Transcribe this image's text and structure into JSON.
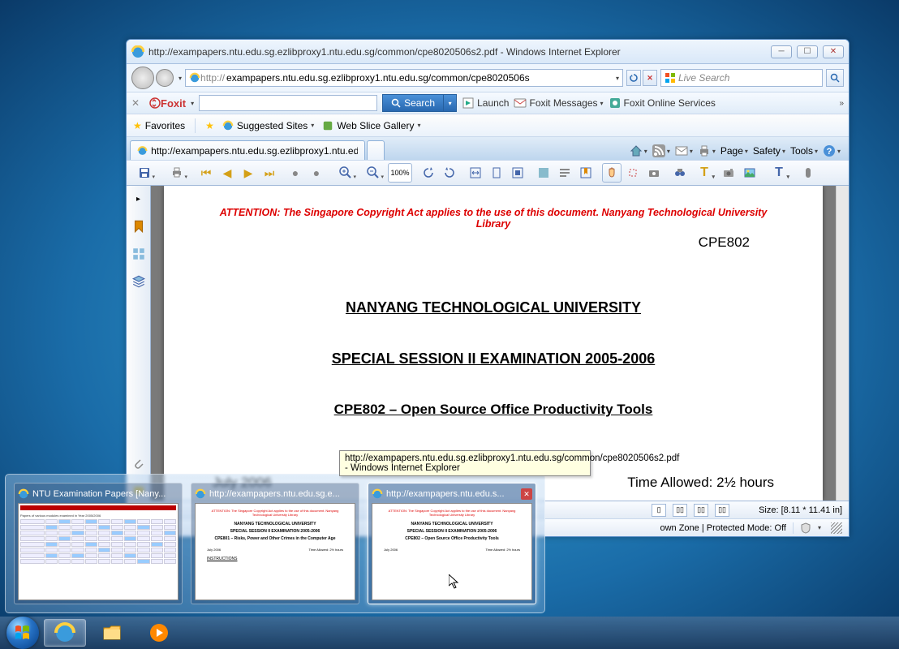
{
  "window": {
    "title": "http://exampapers.ntu.edu.sg.ezlibproxy1.ntu.edu.sg/common/cpe8020506s2.pdf - Windows Internet Explorer",
    "url_display_prefix": "http://",
    "url_display": "exampapers.ntu.edu.sg.ezlibproxy1.ntu.edu.sg/common/cpe8020506s",
    "search_placeholder": "Live Search"
  },
  "foxit": {
    "brand": "Foxit",
    "search_btn": "Search",
    "launch": "Launch",
    "messages": "Foxit Messages",
    "services": "Foxit Online Services"
  },
  "favbar": {
    "favorites": "Favorites",
    "suggested": "Suggested Sites",
    "webslice": "Web Slice Gallery"
  },
  "tab": {
    "text": "http://exampapers.ntu.edu.sg.ezlibproxy1.ntu.edu..."
  },
  "cmdbar": {
    "page": "Page",
    "safety": "Safety",
    "tools": "Tools"
  },
  "pdftoolbar": {
    "zoom": "100%"
  },
  "document": {
    "copyright": "ATTENTION: The Singapore Copyright Act applies to the use of this document. Nanyang Technological University Library",
    "course_code": "CPE802",
    "university": "NANYANG TECHNOLOGICAL UNIVERSITY",
    "exam_title": "SPECIAL SESSION II EXAMINATION 2005-2006",
    "course_title": "CPE802 – Open Source Office Productivity Tools",
    "date": "July 2006",
    "time_allowed": "Time Allowed: 2½ hours"
  },
  "tooltip": {
    "text": "http://exampapers.ntu.edu.sg.ezlibproxy1.ntu.edu.sg/common/cpe8020506s2.pdf - Windows Internet Explorer"
  },
  "viewbar": {
    "size": "Size: [8.11 * 11.41 in]"
  },
  "statusbar": {
    "zone": "own Zone | Protected Mode: Off"
  },
  "previews": [
    {
      "title": "NTU Examination Papers [Nany..."
    },
    {
      "title": "http://exampapers.ntu.edu.sg.e..."
    },
    {
      "title": "http://exampapers.ntu.edu.s..."
    }
  ],
  "thumb2": {
    "red": "ATTENTION: The Singapore Copyright Act applies to the use of this document. Nanyang Technological University Library",
    "uni": "NANYANG TECHNOLOGICAL UNIVERSITY",
    "exam": "SPECIAL SESSION II EXAMINATION 2005-2006",
    "course": "CPE801 – Risks, Power and Other Crimes in the Computer Age",
    "date": "July 2006",
    "time": "Time Allowed: 2½ hours",
    "instr": "INSTRUCTIONS"
  },
  "thumb3": {
    "red": "ATTENTION: The Singapore Copyright Act applies to the use of this document. Nanyang Technological University Library",
    "uni": "NANYANG TECHNOLOGICAL UNIVERSITY",
    "exam": "SPECIAL SESSION II EXAMINATION 2005-2006",
    "course": "CPE802 – Open Source Office Productivity Tools",
    "date": "July 2006",
    "time": "Time Allowed: 2½ hours"
  }
}
